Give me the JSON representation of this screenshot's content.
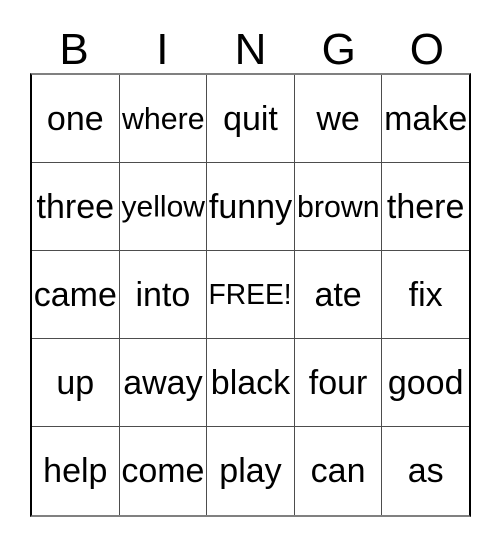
{
  "card": {
    "type": "bingo-card",
    "headers": [
      "B",
      "I",
      "N",
      "G",
      "O"
    ],
    "free_space_label": "FREE!",
    "free_space_position": {
      "row": 2,
      "col": 2
    },
    "grid": [
      [
        "one",
        "where",
        "quit",
        "we",
        "make"
      ],
      [
        "three",
        "yellow",
        "funny",
        "brown",
        "there"
      ],
      [
        "came",
        "into",
        "FREE!",
        "ate",
        "fix"
      ],
      [
        "up",
        "away",
        "black",
        "four",
        "good"
      ],
      [
        "help",
        "come",
        "play",
        "can",
        "as"
      ]
    ],
    "colors": {
      "text": "#000000",
      "grid_line": "#4d4d4d",
      "outer_border": "#000000",
      "background": "#ffffff"
    }
  }
}
